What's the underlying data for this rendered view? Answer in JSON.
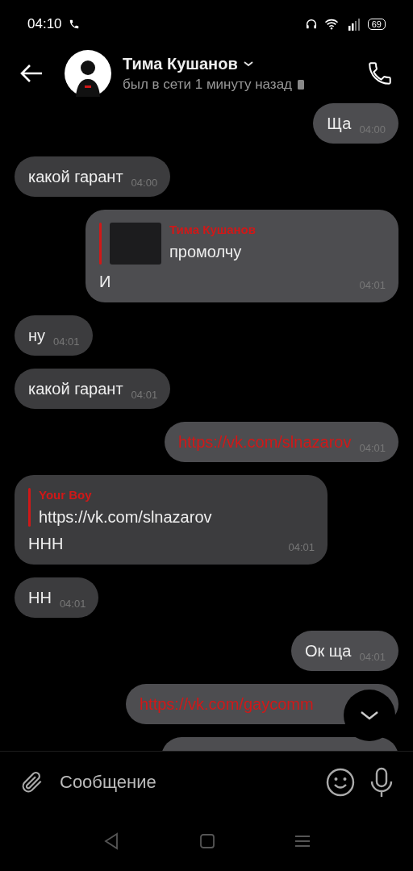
{
  "status_bar": {
    "time": "04:10",
    "battery": "69"
  },
  "header": {
    "name": "Тима Кушанов",
    "status": "был в сети 1 минуту назад"
  },
  "messages": [
    {
      "kind": "text",
      "outgoing": true,
      "text": "Ща",
      "time": "04:00"
    },
    {
      "kind": "text",
      "outgoing": false,
      "text": "какой гарант",
      "time": "04:00"
    },
    {
      "kind": "reply",
      "outgoing": true,
      "reply_author": "Тима Кушанов",
      "reply_text": "промолчу",
      "reply_thumb": true,
      "text": "И",
      "time": "04:01"
    },
    {
      "kind": "text",
      "outgoing": false,
      "text": "ну",
      "time": "04:01"
    },
    {
      "kind": "text",
      "outgoing": false,
      "text": "какой гарант",
      "time": "04:01"
    },
    {
      "kind": "link",
      "outgoing": true,
      "text": "https://vk.com/slnazarov",
      "time": "04:01"
    },
    {
      "kind": "reply",
      "outgoing": false,
      "reply_author": "Your Boy",
      "reply_text": "https://vk.com/slnazarov",
      "reply_thumb": false,
      "text": "ННН",
      "time": "04:01"
    },
    {
      "kind": "text",
      "outgoing": false,
      "text": "НН",
      "time": "04:01"
    },
    {
      "kind": "text",
      "outgoing": true,
      "text": "Ок ща",
      "time": "04:01"
    },
    {
      "kind": "link",
      "outgoing": true,
      "text": "https://vk.com/gaycomm"
    },
    {
      "kind": "text",
      "outgoing": true
    }
  ],
  "composer": {
    "placeholder": "Сообщение"
  }
}
